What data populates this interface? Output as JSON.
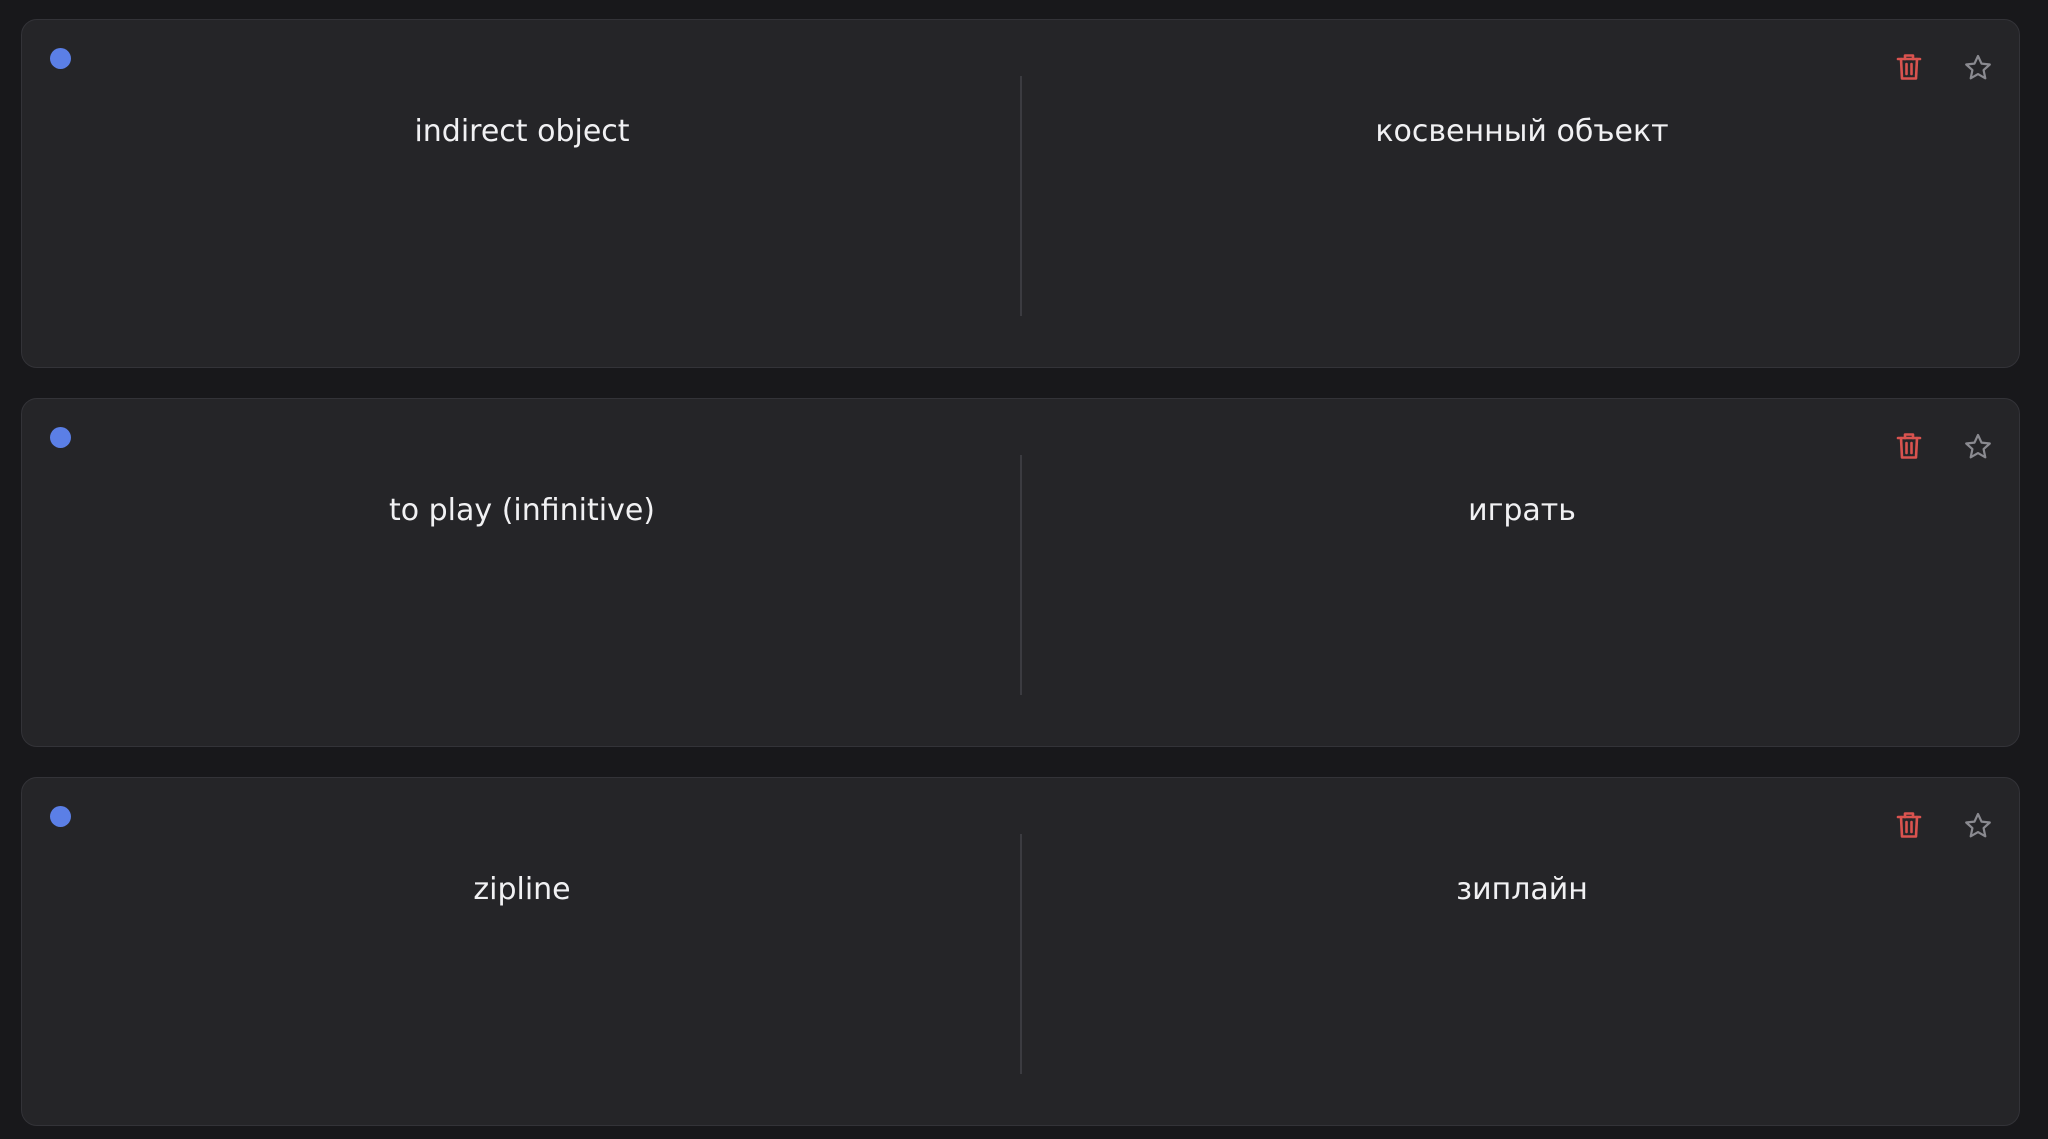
{
  "colors": {
    "background": "#18181b",
    "card": "#252528",
    "status_dot": "#5b7fe6",
    "delete_icon": "#d9534f",
    "star_icon": "#8a8a90",
    "text": "#f1f1f3"
  },
  "cards": [
    {
      "term": "indirect object",
      "definition": "косвенный объект",
      "status_icon": "blue-dot-icon"
    },
    {
      "term": "to play (infinitive)",
      "definition": "играть",
      "status_icon": "blue-dot-icon"
    },
    {
      "term": "zipline",
      "definition": "зиплайн",
      "status_icon": "blue-dot-icon"
    }
  ],
  "icons": {
    "delete": "trash-icon",
    "favorite": "star-outline-icon"
  }
}
